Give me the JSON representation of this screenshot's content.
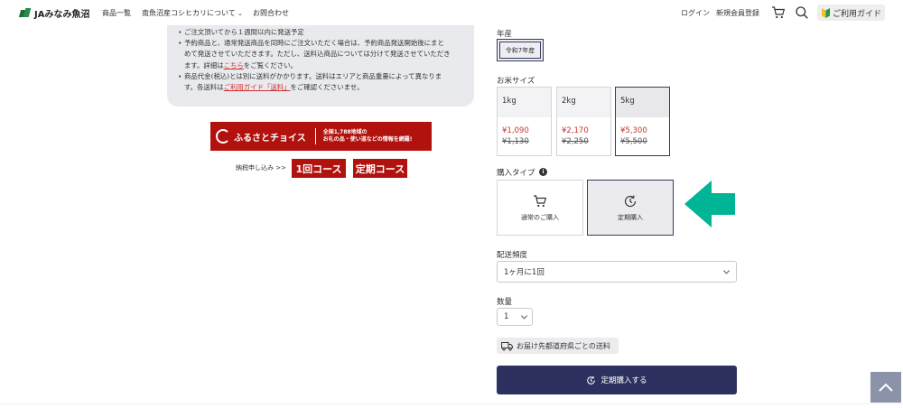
{
  "header": {
    "logo_text": "JAみなみ魚沼",
    "nav": [
      {
        "label": "商品一覧"
      },
      {
        "label": "南魚沼産コシヒカリについて"
      },
      {
        "label": "お問合わせ"
      }
    ],
    "login": "ログイン",
    "register": "新規会員登録",
    "guide": "ご利用ガイド",
    "icons": {
      "cart": "cart-icon",
      "search": "search-icon",
      "guide": "beginner-mark-icon"
    }
  },
  "notice": {
    "line1": "ご注文頂いてから１週間以内に発送予定",
    "item2_a": "予約商品と、通常発送商品を同時にご注文いただく場合は、予約商品発送開始後にまと",
    "item2_b": "めて発送させていただきます。ただし、送料込商品については分けて発送させていただき",
    "item2_c_pre": "ます。詳細は",
    "item2_c_link": "こちら",
    "item2_c_post": "をご覧ください。",
    "item3_a": "商品代金(税込)とは別に送料がかかります。送料はエリアと商品重量によって異なりま",
    "item3_b_pre": "す。各送料は",
    "item3_b_link": "ご利用ガイド「送料」",
    "item3_b_post": "をご確認くださいませ。"
  },
  "furusato": {
    "title": "ふるさとチョイス",
    "sub1": "全国1,788地域の",
    "sub2": "お礼の品・使い道などの情報を網羅!",
    "apply_label": "納税申し込み >>",
    "course_once": "1回コース",
    "course_regular": "定期コース"
  },
  "product": {
    "year_label": "年産",
    "year_value": "令和7年産",
    "size_label": "お米サイズ",
    "sizes": [
      {
        "label": "1kg",
        "price": "¥1,090",
        "original": "¥1,130"
      },
      {
        "label": "2kg",
        "price": "¥2,170",
        "original": "¥2,250"
      },
      {
        "label": "5kg",
        "price": "¥5,300",
        "original": "¥5,500"
      }
    ],
    "selected_size": "5kg",
    "type_label": "購入タイプ",
    "types": [
      {
        "label": "通常のご購入",
        "icon": "cart-icon"
      },
      {
        "label": "定期購入",
        "icon": "clock-refresh-icon"
      }
    ],
    "selected_type": "定期購入",
    "freq_label": "配送頻度",
    "freq_value": "1ヶ月に1回",
    "qty_label": "数量",
    "qty_value": "1",
    "shipping_link": "お届け先都道府県ごとの送料",
    "buy_button": "定期購入する"
  },
  "colors": {
    "accent": "#2d3160",
    "furusato_red": "#b2120d",
    "price_red": "#d03030",
    "arrow_green": "#00b496"
  }
}
